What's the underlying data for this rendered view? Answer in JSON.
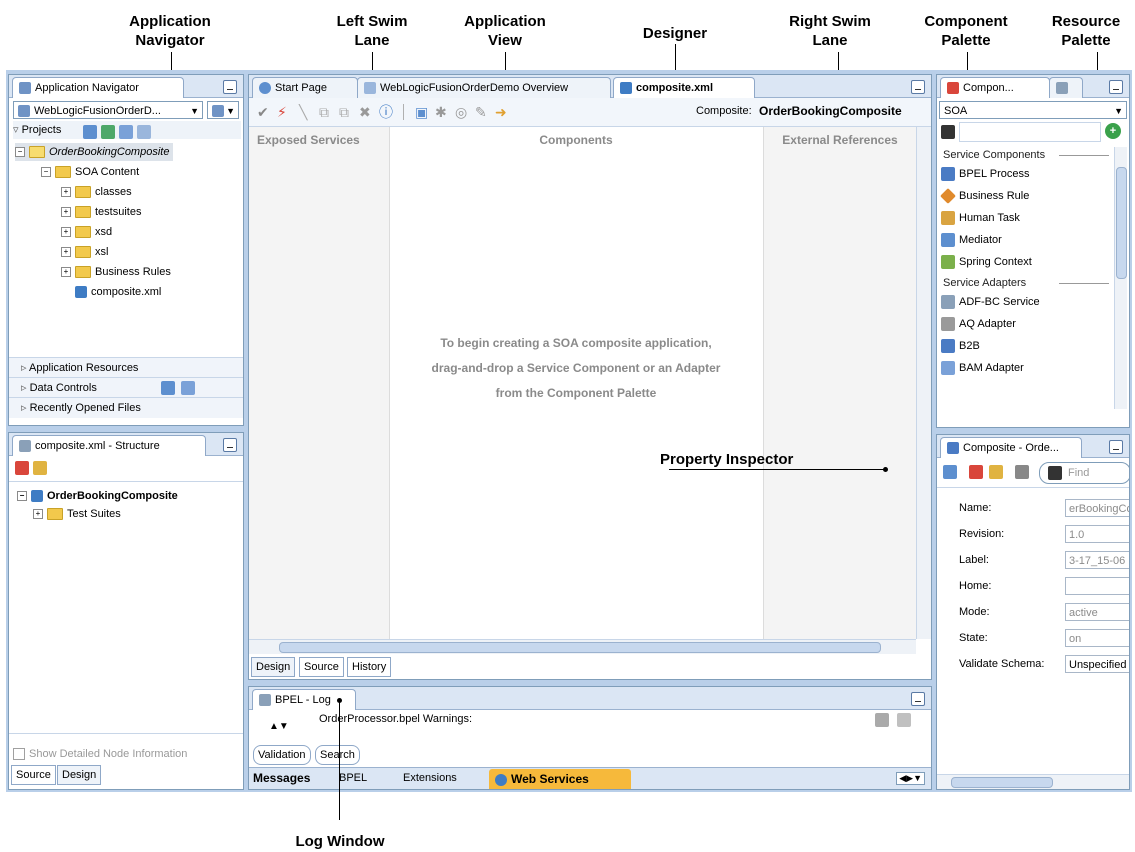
{
  "callouts": {
    "application_navigator": "Application\nNavigator",
    "left_swim_lane": "Left Swim\nLane",
    "application_view": "Application\nView",
    "designer": "Designer",
    "right_swim_lane": "Right Swim\nLane",
    "component_palette": "Component\nPalette",
    "resource_palette": "Resource\nPalette",
    "property_inspector": "Property Inspector",
    "log_window": "Log Window"
  },
  "navigator": {
    "tab_label": "Application Navigator",
    "app_combo": "WebLogicFusionOrderD...",
    "projects_label": "Projects",
    "tree": [
      "OrderBookingComposite",
      "SOA Content",
      "classes",
      "testsuites",
      "xsd",
      "xsl",
      "Business Rules",
      "composite.xml"
    ],
    "accordions": [
      "Application Resources",
      "Data Controls",
      "Recently Opened Files"
    ]
  },
  "structure": {
    "tab_label": "composite.xml - Structure",
    "tree": [
      "OrderBookingComposite",
      "Test Suites"
    ],
    "show_detailed": "Show Detailed Node Information",
    "bottom_tabs": [
      "Source",
      "Design"
    ]
  },
  "editor": {
    "tabs": [
      "Start Page",
      "WebLogicFusionOrderDemo Overview",
      "composite.xml"
    ],
    "composite_prefix": "Composite:",
    "composite_name": "OrderBookingComposite",
    "lanes": [
      "Exposed Services",
      "Components",
      "External References"
    ],
    "hint_lines": [
      "To begin creating a SOA composite application,",
      "drag-and-drop a Service Component or an Adapter",
      "from the Component Palette"
    ],
    "bottom_tabs": [
      "Design",
      "Source",
      "History"
    ]
  },
  "log": {
    "tab_label": "BPEL - Log",
    "message": "OrderProcessor.bpel Warnings:",
    "sub_tabs": [
      "Validation",
      "Search"
    ],
    "bottom_tabs": [
      "Messages",
      "BPEL",
      "Extensions",
      "Web Services"
    ]
  },
  "palette": {
    "tab_label": "Compon...",
    "category": "SOA",
    "sections": [
      "Service Components",
      "Service Adapters"
    ],
    "service_components": [
      "BPEL Process",
      "Business Rule",
      "Human Task",
      "Mediator",
      "Spring Context"
    ],
    "service_adapters": [
      "ADF-BC Service",
      "AQ Adapter",
      "B2B",
      "BAM Adapter"
    ]
  },
  "inspector": {
    "tab_label": "Composite - Orde...",
    "find_placeholder": "Find",
    "fields": [
      {
        "label": "Name:",
        "value": "erBookingCo"
      },
      {
        "label": "Revision:",
        "value": "1.0"
      },
      {
        "label": "Label:",
        "value": "3-17_15-06"
      },
      {
        "label": "Home:",
        "value": ""
      },
      {
        "label": "Mode:",
        "value": "active"
      },
      {
        "label": "State:",
        "value": "on"
      },
      {
        "label": "Validate Schema:",
        "value": "Unspecified"
      }
    ]
  },
  "colors": {
    "frame": "#b9cfe9",
    "titlebar": "#dbe6f4",
    "web_services_tab": "#f6b93b"
  }
}
